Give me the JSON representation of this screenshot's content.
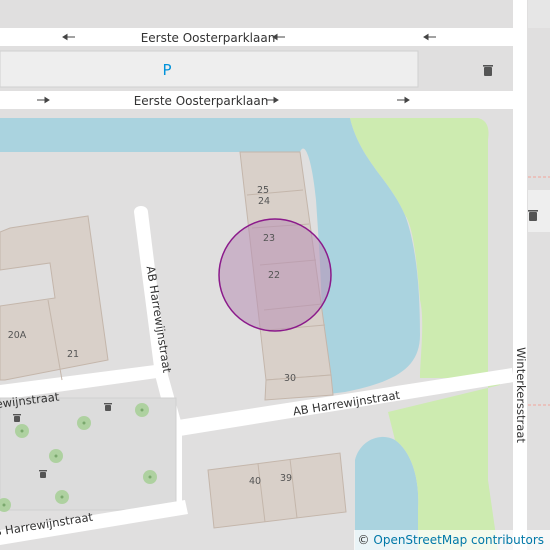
{
  "map": {
    "streets": [
      {
        "id": "street-top",
        "name": "Eerste Oosterparklaan"
      },
      {
        "id": "street-second",
        "name": "Eerste Oosterparklaan"
      },
      {
        "id": "street-diag",
        "name": "AB Harrewijnstraat"
      },
      {
        "id": "street-bottom",
        "name": "AB Harrewijnstraat"
      },
      {
        "id": "street-left",
        "name": "AB Harrewijnstraat"
      },
      {
        "id": "street-bottom-left",
        "name": "AB Harrewijnstraat"
      },
      {
        "id": "street-right",
        "name": "Winterkersstraat"
      }
    ],
    "house_numbers": [
      "25",
      "24",
      "23",
      "22",
      "30",
      "20A",
      "21",
      "40",
      "39"
    ],
    "parking_label": "P",
    "icons": [
      "oneway-arrow-icon",
      "waste-basket-icon",
      "tree-icon",
      "parking-icon"
    ],
    "colors": {
      "background": "#e0dfdf",
      "water": "#aad3df",
      "park": "#cdebb0",
      "building": "#d9d0c9",
      "building_outline": "#c4b6ab",
      "road": "#ffffff",
      "parking": "#eeeeee",
      "parking_text": "#0092da",
      "highlight_fill": "#b88fb4",
      "highlight_stroke": "#8b1a8b",
      "tree": "#aed1a0"
    }
  },
  "attribution": {
    "copyright": "©",
    "text": "OpenStreetMap contributors"
  }
}
